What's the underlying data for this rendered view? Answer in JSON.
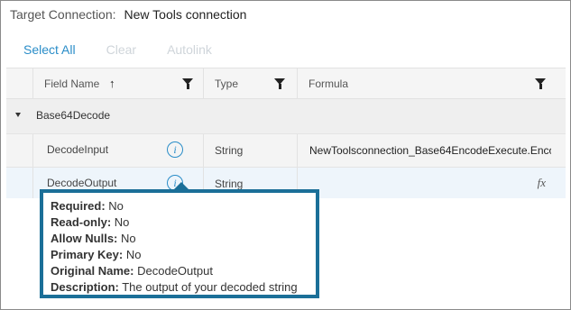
{
  "target": {
    "label": "Target Connection:",
    "value": "New Tools connection"
  },
  "actions": {
    "select_all": "Select All",
    "clear": "Clear",
    "autolink": "Autolink"
  },
  "columns": {
    "field_name": "Field Name",
    "sort_indicator": "↑",
    "type": "Type",
    "formula": "Formula"
  },
  "group": {
    "label": "Base64Decode"
  },
  "rows": [
    {
      "field": "DecodeInput",
      "type": "String",
      "formula": "NewToolsconnection_Base64EncodeExecute.Encod..."
    },
    {
      "field": "DecodeOutput",
      "type": "String",
      "formula": ""
    }
  ],
  "tooltip": {
    "required_label": "Required:",
    "required_value": "No",
    "readonly_label": "Read-only:",
    "readonly_value": "No",
    "nulls_label": "Allow Nulls:",
    "nulls_value": "No",
    "pk_label": "Primary Key:",
    "pk_value": "No",
    "orig_label": "Original Name:",
    "orig_value": "DecodeOutput",
    "desc_label": "Description:",
    "desc_value": "The output of your decoded string"
  },
  "icons": {
    "info": "info-icon",
    "filter": "filter-icon",
    "fx": "fx-icon",
    "caret": "caret-down-icon"
  },
  "colors": {
    "accent": "#2a8dc8",
    "tooltip_border": "#1b6f98",
    "disabled": "#cfd5da"
  }
}
